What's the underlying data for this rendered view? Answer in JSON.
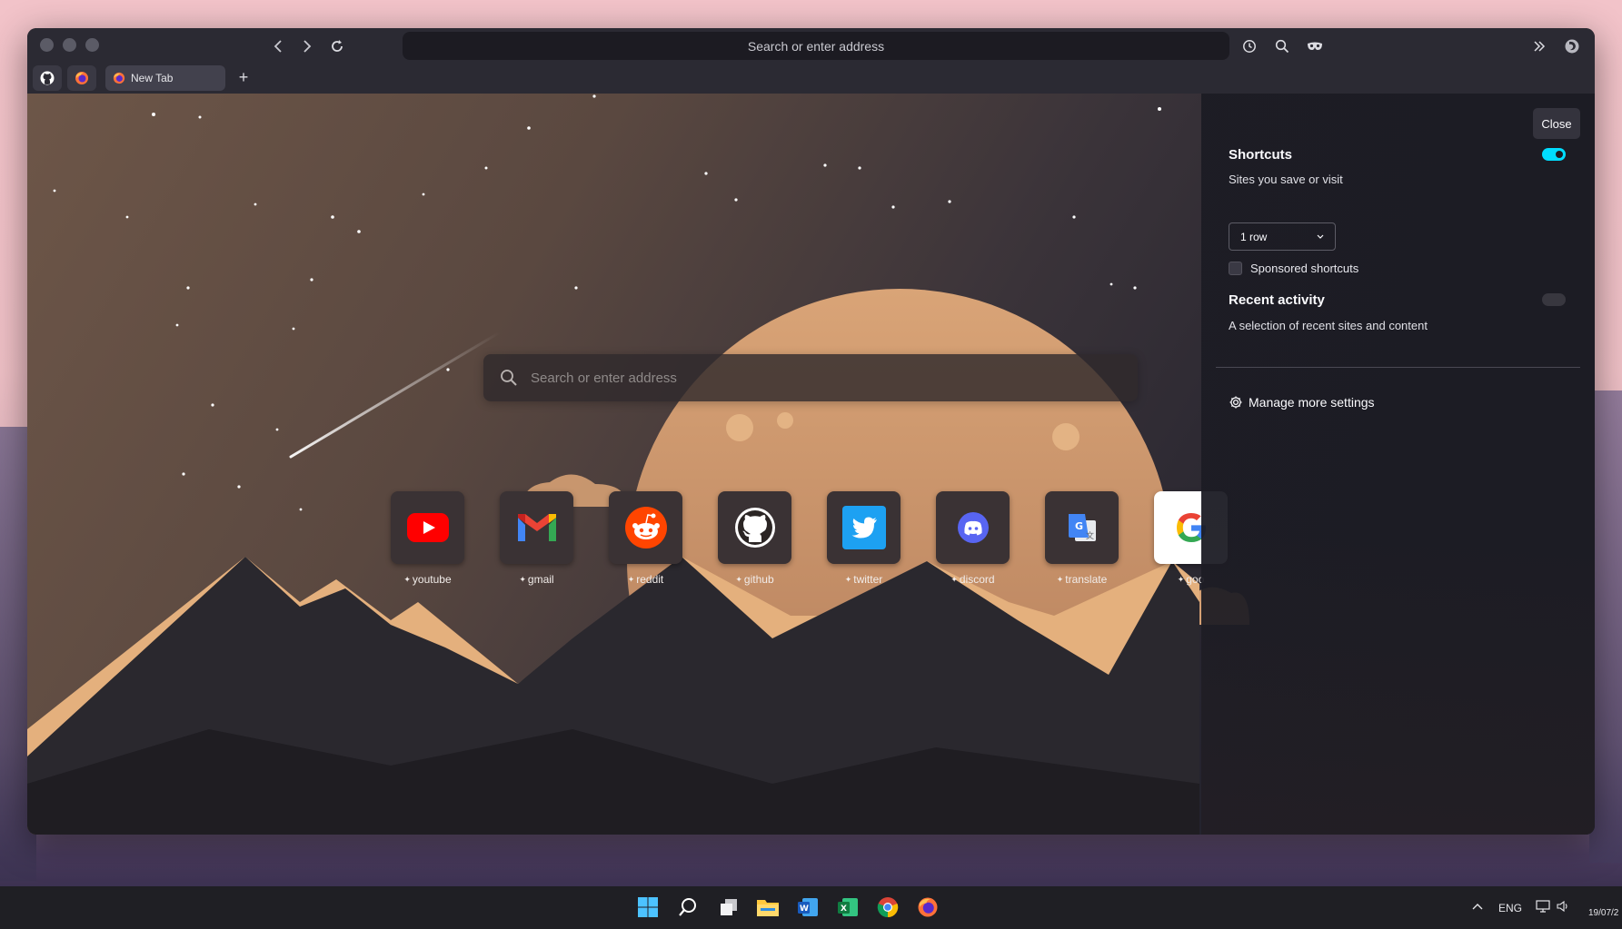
{
  "browser": {
    "address_placeholder": "Search or enter address",
    "tab_title": "New Tab"
  },
  "newtab": {
    "search_placeholder": "Search or enter address",
    "shortcuts": [
      {
        "label": "youtube",
        "icon": "youtube-icon",
        "color": "#ff0000"
      },
      {
        "label": "gmail",
        "icon": "gmail-icon",
        "color": "#ea4335"
      },
      {
        "label": "reddit",
        "icon": "reddit-icon",
        "color": "#ff4500"
      },
      {
        "label": "github",
        "icon": "github-icon",
        "color": "#ffffff"
      },
      {
        "label": "twitter",
        "icon": "twitter-icon",
        "color": "#1da1f2"
      },
      {
        "label": "discord",
        "icon": "discord-icon",
        "color": "#5865f2"
      },
      {
        "label": "translate",
        "icon": "google-translate-icon",
        "color": "#4285f4"
      },
      {
        "label": "goo",
        "icon": "google-icon",
        "color": "#4285f4"
      }
    ]
  },
  "panel": {
    "close_label": "Close",
    "shortcuts_title": "Shortcuts",
    "shortcuts_sub": "Sites you save or visit",
    "shortcuts_enabled": true,
    "rows_value": "1 row",
    "sponsored_label": "Sponsored shortcuts",
    "sponsored_checked": false,
    "recent_title": "Recent activity",
    "recent_sub": "A selection of recent sites and content",
    "recent_enabled": false,
    "manage_label": "Manage more settings"
  },
  "taskbar": {
    "language": "ENG",
    "date": "19/07/2"
  },
  "colors": {
    "accent": "#00ddff",
    "panel_bg": "#1c1c24",
    "moon": "#d9a073"
  }
}
